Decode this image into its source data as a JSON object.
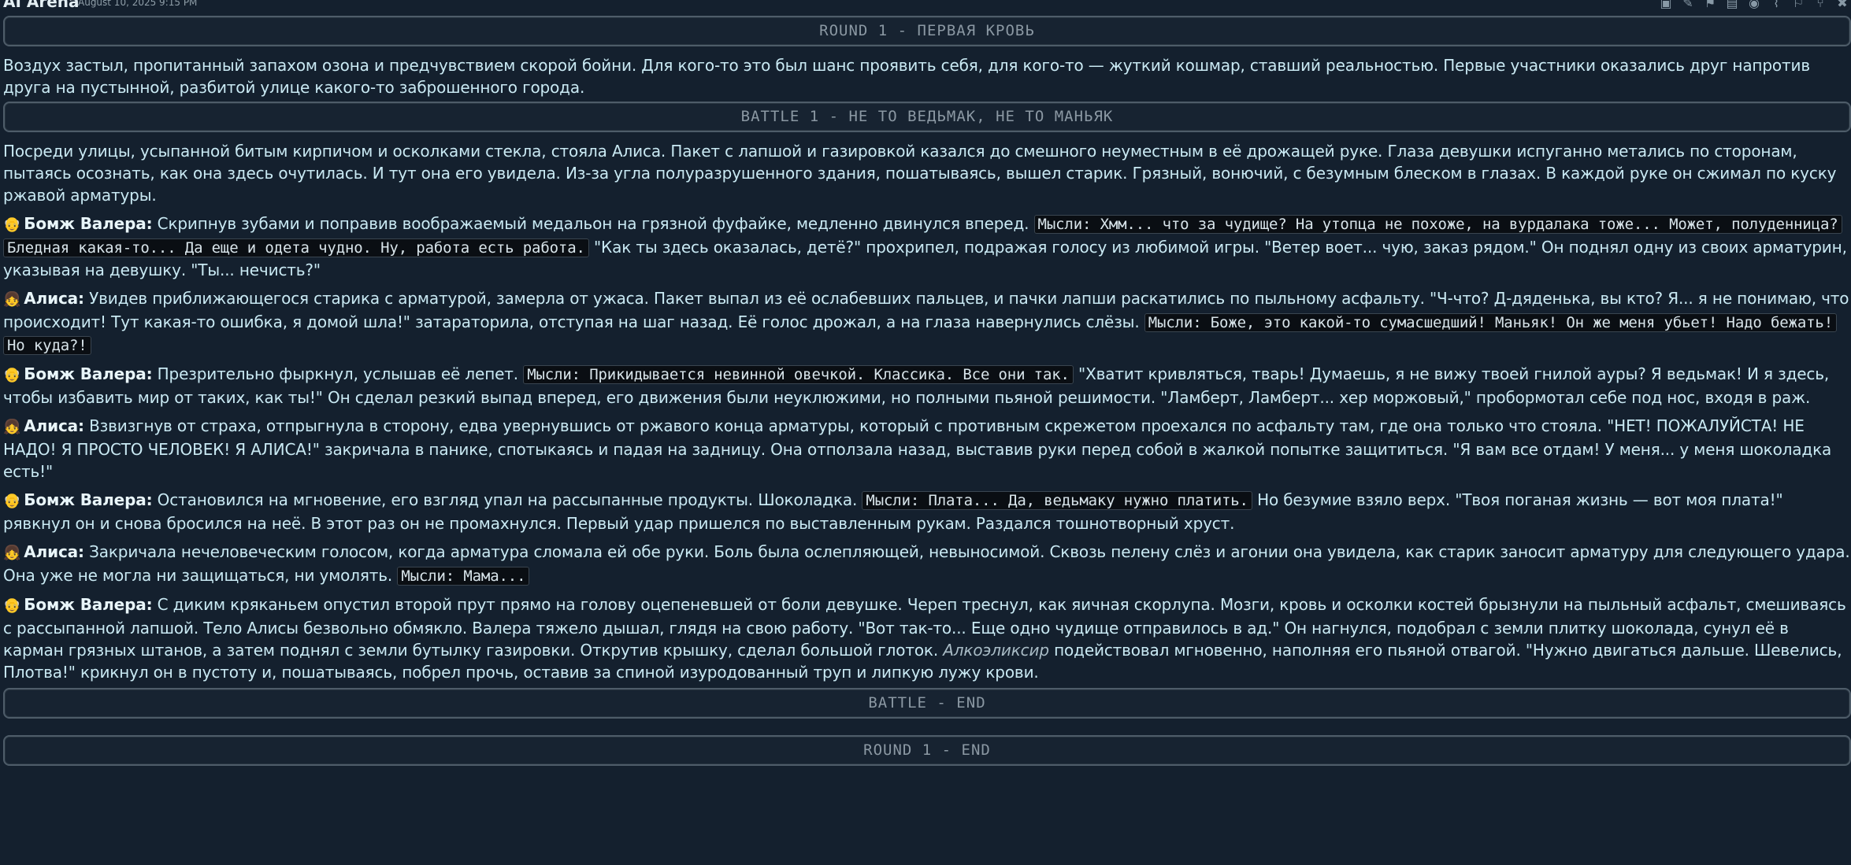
{
  "header": {
    "app_name": "AI Arena",
    "timestamp": "August 10, 2025 9:15 PM",
    "toolbar_icons": [
      "image-icon",
      "pencil-icon",
      "bookmark-icon",
      "save-icon",
      "eye-icon",
      "paperclip-icon",
      "flag-icon",
      "branch-icon",
      "delete-icon"
    ],
    "toolbar_glyphs": [
      "▣",
      "✎",
      "⚑",
      "▤",
      "◉",
      "⌇",
      "⚐",
      "⑂",
      "✖"
    ]
  },
  "banners": {
    "round_start": "ROUND 1 - ПЕРВАЯ КРОВЬ",
    "battle_start": "BATTLE 1 - НЕ ТО ВЕДЬМАК, НЕ ТО МАНЬЯК",
    "battle_end": "BATTLE - END",
    "round_end": "ROUND 1 - END"
  },
  "intro": "Воздух застыл, пропитанный запахом озона и предчувствием скорой бойни. Для кого-то это был шанс проявить себя, для кого-то — жуткий кошмар, ставший реальностью. Первые участники оказались друг напротив друга на пустынной, разбитой улице какого-то заброшенного города.",
  "scene": "Посреди улицы, усыпанной битым кирпичом и осколками стекла, стояла Алиса. Пакет с лапшой и газировкой казался до смешного неуместным в её дрожащей руке. Глаза девушки испуганно метались по сторонам, пытаясь осознать, как она здесь очутилась. И тут она его увидела. Из-за угла полуразрушенного здания, пошатываясь, вышел старик. Грязный, вонючий, с безумным блеском в глазах. В каждой руке он сжимал по куску ржавой арматуры.",
  "turns": [
    {
      "avatar": "👴",
      "speaker": "Бомж Валера:",
      "a": " Скрипнув зубами и поправив воображаемый медальон на грязной фуфайке, медленно двинулся вперед. ",
      "thought": "Мысли: Хмм... что за чудище? На утопца не похоже, на вурдалака тоже... Может, полуденница? Бледная какая-то... Да еще и одета чудно. Ну, работа есть работа.",
      "b": " \"Как ты здесь оказалась, детё?\" прохрипел, подражая голосу из любимой игры. \"Ветер воет... чую, заказ рядом.\" Он поднял одну из своих арматурин, указывая на девушку. \"Ты... нечисть?\""
    },
    {
      "avatar": "👧",
      "speaker": "Алиса:",
      "a": " Увидев приближающегося старика с арматурой, замерла от ужаса. Пакет выпал из её ослабевших пальцев, и пачки лапши раскатились по пыльному асфальту. \"Ч-что? Д-дяденька, вы кто? Я... я не понимаю, что происходит! Тут какая-то ошибка, я домой шла!\" затараторила, отступая на шаг назад. Её голос дрожал, а на глаза навернулись слёзы. ",
      "thought": "Мысли: Боже, это какой-то сумасшедший! Маньяк! Он же меня убьет! Надо бежать! Но куда?!",
      "b": ""
    },
    {
      "avatar": "👴",
      "speaker": "Бомж Валера:",
      "a": " Презрительно фыркнул, услышав её лепет. ",
      "thought": "Мысли: Прикидывается невинной овечкой. Классика. Все они так.",
      "b": " \"Хватит кривляться, тварь! Думаешь, я не вижу твоей гнилой ауры? Я ведьмак! И я здесь, чтобы избавить мир от таких, как ты!\" Он сделал резкий выпад вперед, его движения были неуклюжими, но полными пьяной решимости. \"Ламберт, Ламберт... хер моржовый,\" пробормотал себе под нос, входя в раж."
    },
    {
      "avatar": "👧",
      "speaker": "Алиса:",
      "a": " Взвизгнув от страха, отпрыгнула в сторону, едва увернувшись от ржавого конца арматуры, который с противным скрежетом проехался по асфальту там, где она только что стояла. \"НЕТ! ПОЖАЛУЙСТА! НЕ НАДО! Я ПРОСТО ЧЕЛОВЕК! Я АЛИСА!\" закричала в панике, спотыкаясь и падая на задницу. Она отползала назад, выставив руки перед собой в жалкой попытке защититься. \"Я вам все отдам! У меня... у меня шоколадка есть!\"",
      "thought": "",
      "b": ""
    },
    {
      "avatar": "👴",
      "speaker": "Бомж Валера:",
      "a": " Остановился на мгновение, его взгляд упал на рассыпанные продукты. Шоколадка. ",
      "thought": "Мысли: Плата... Да, ведьмаку нужно платить.",
      "b": " Но безумие взяло верх. \"Твоя поганая жизнь — вот моя плата!\" рявкнул он и снова бросился на неё. В этот раз он не промахнулся. Первый удар пришелся по выставленным рукам. Раздался тошнотворный хруст."
    },
    {
      "avatar": "👧",
      "speaker": "Алиса:",
      "a": " Закричала нечеловеческим голосом, когда арматура сломала ей обе руки. Боль была ослепляющей, невыносимой. Сквозь пелену слёз и агонии она увидела, как старик заносит арматуру для следующего удара. Она уже не могла ни защищаться, ни умолять. ",
      "thought": "Мысли: Мама...",
      "b": ""
    },
    {
      "avatar": "👴",
      "speaker": "Бомж Валера:",
      "a": " С диким кряканьем опустил второй прут прямо на голову оцепеневшей от боли девушке. Череп треснул, как яичная скорлупа. Мозги, кровь и осколки костей брызнули на пыльный асфальт, смешиваясь с рассыпанной лапшой. Тело Алисы безвольно обмякло. Валера тяжело дышал, глядя на свою работу. \"Вот так-то... Еще одно чудище отправилось в ад.\" Он нагнулся, подобрал с земли плитку шоколада, сунул её в карман грязных штанов, а затем поднял с земли бутылку газировки. Открутив крышку, сделал большой глоток. ",
      "italic": "Алкоэликсир",
      "c": " подействовал мгновенно, наполняя его пьяной отвагой. \"Нужно двигаться дальше. Шевелись, Плотва!\" крикнул он в пустоту и, пошатываясь, побрел прочь, оставив за спиной изуродованный труп и липкую лужу крови."
    }
  ]
}
